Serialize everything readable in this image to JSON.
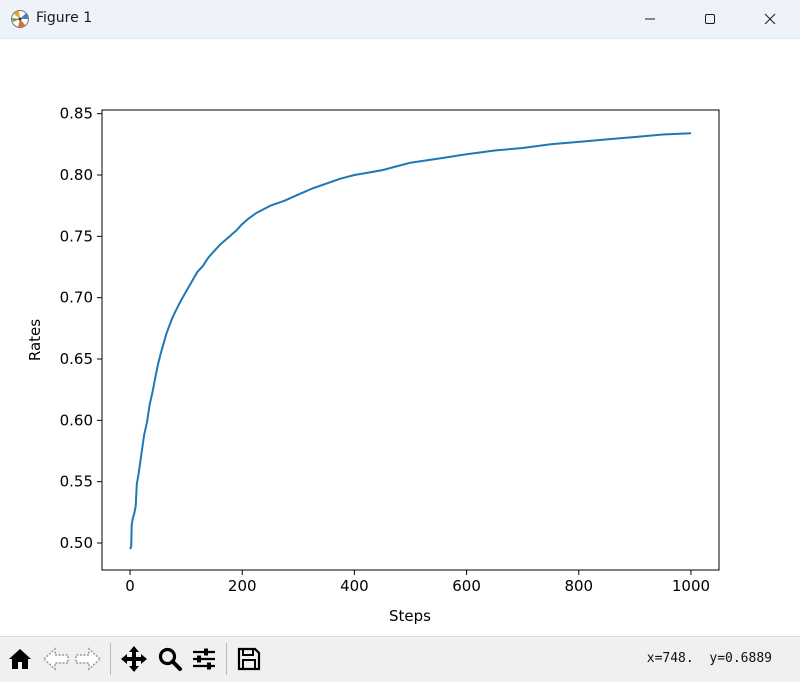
{
  "window": {
    "title": "Figure 1",
    "icons": {
      "app": "matplotlib-icon",
      "minimize": "minimize-icon",
      "maximize": "maximize-icon",
      "close": "close-icon"
    }
  },
  "toolbar": {
    "tools": [
      {
        "name": "home-button",
        "icon": "home-icon"
      },
      {
        "name": "back-button",
        "icon": "arrow-left-icon"
      },
      {
        "name": "forward-button",
        "icon": "arrow-right-icon"
      },
      {
        "name": "pan-button",
        "icon": "move-icon"
      },
      {
        "name": "zoom-button",
        "icon": "magnifier-icon"
      },
      {
        "name": "configure-subplots-button",
        "icon": "sliders-icon"
      },
      {
        "name": "save-button",
        "icon": "floppy-disk-icon"
      }
    ],
    "coords": {
      "x_text": "x=748.",
      "y_text": "y=0.6889"
    }
  },
  "chart_data": {
    "type": "line",
    "title": "",
    "xlabel": "Steps",
    "ylabel": "Rates",
    "xlim": [
      -50,
      1050
    ],
    "ylim": [
      0.478,
      0.853
    ],
    "xticks": [
      0,
      200,
      400,
      600,
      800,
      1000
    ],
    "xtick_labels": [
      "0",
      "200",
      "400",
      "600",
      "800",
      "1000"
    ],
    "yticks": [
      0.5,
      0.55,
      0.6,
      0.65,
      0.7,
      0.75,
      0.8,
      0.85
    ],
    "ytick_labels": [
      "0.50",
      "0.55",
      "0.60",
      "0.65",
      "0.70",
      "0.75",
      "0.80",
      "0.85"
    ],
    "grid": false,
    "series": [
      {
        "color": "#1f77b4",
        "x": [
          0,
          2,
          3,
          5,
          8,
          10,
          12,
          15,
          18,
          20,
          25,
          30,
          35,
          40,
          45,
          50,
          55,
          60,
          65,
          70,
          75,
          80,
          90,
          100,
          110,
          120,
          130,
          140,
          150,
          160,
          175,
          190,
          200,
          210,
          225,
          250,
          275,
          300,
          325,
          350,
          375,
          400,
          425,
          450,
          475,
          500,
          530,
          560,
          600,
          650,
          700,
          750,
          800,
          850,
          900,
          950,
          1000
        ],
        "values": [
          0.495,
          0.497,
          0.515,
          0.52,
          0.525,
          0.53,
          0.548,
          0.556,
          0.565,
          0.572,
          0.588,
          0.598,
          0.613,
          0.623,
          0.635,
          0.646,
          0.655,
          0.663,
          0.671,
          0.677,
          0.683,
          0.688,
          0.697,
          0.705,
          0.713,
          0.721,
          0.726,
          0.733,
          0.738,
          0.743,
          0.749,
          0.755,
          0.76,
          0.764,
          0.769,
          0.775,
          0.779,
          0.784,
          0.789,
          0.793,
          0.797,
          0.8,
          0.802,
          0.804,
          0.807,
          0.81,
          0.812,
          0.814,
          0.817,
          0.82,
          0.822,
          0.825,
          0.827,
          0.829,
          0.831,
          0.833,
          0.834
        ]
      }
    ]
  }
}
